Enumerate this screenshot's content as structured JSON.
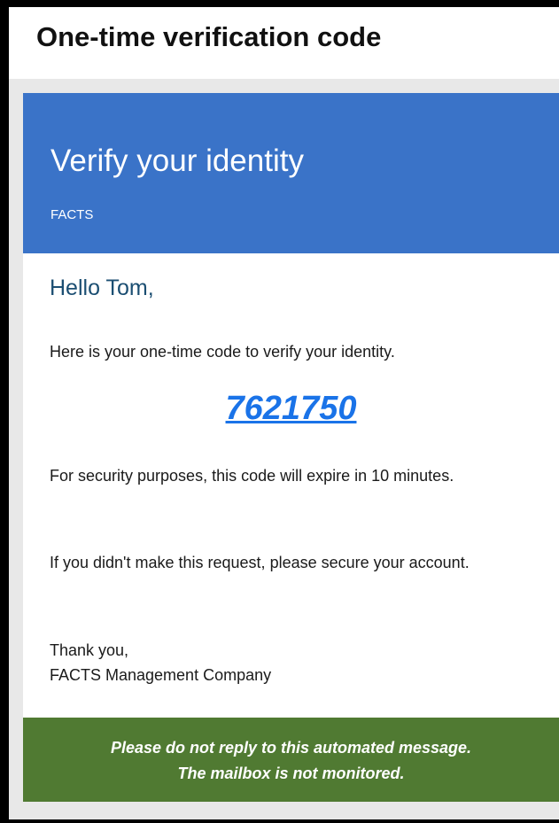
{
  "email": {
    "subject": "One-time verification code"
  },
  "banner": {
    "title": "Verify your identity",
    "brand": "FACTS"
  },
  "message": {
    "greeting": "Hello Tom,",
    "intro": "Here is your one-time code to verify your identity.",
    "code": "7621750",
    "expiry_notice": "For security purposes, this code will expire in 10 minutes.",
    "security_notice": "If you didn't make this request, please secure your account.",
    "signoff_line1": "Thank you,",
    "signoff_line2": "FACTS Management Company"
  },
  "footer": {
    "line1": "Please do not reply to this automated message.",
    "line2": "The mailbox is not monitored."
  },
  "colors": {
    "banner": "#3a73c8",
    "footer": "#507a32",
    "code_link": "#1a73e8",
    "greeting": "#1b4e72",
    "page_background": "#e8e8e8"
  }
}
